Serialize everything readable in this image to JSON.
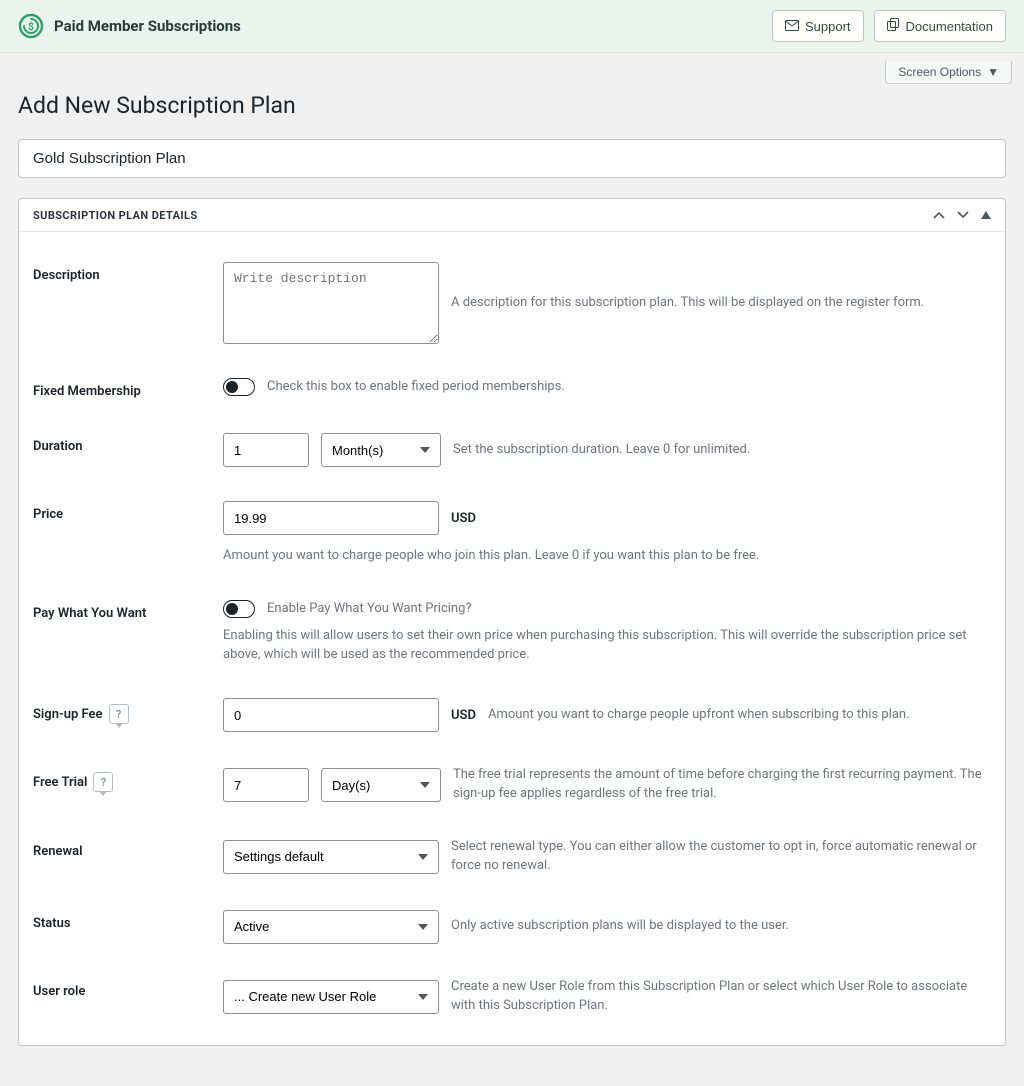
{
  "header": {
    "plugin_title": "Paid Member Subscriptions",
    "support_label": "Support",
    "documentation_label": "Documentation",
    "screen_options_label": "Screen Options"
  },
  "page": {
    "title": "Add New Subscription Plan",
    "plan_name": "Gold Subscription Plan"
  },
  "postbox": {
    "title": "SUBSCRIPTION PLAN DETAILS"
  },
  "fields": {
    "description": {
      "label": "Description",
      "placeholder": "Write description",
      "help": "A description for this subscription plan. This will be displayed on the register form."
    },
    "fixed_membership": {
      "label": "Fixed Membership",
      "help": "Check this box to enable fixed period memberships."
    },
    "duration": {
      "label": "Duration",
      "value": "1",
      "unit": "Month(s)",
      "help": "Set the subscription duration. Leave 0 for unlimited."
    },
    "price": {
      "label": "Price",
      "value": "19.99",
      "currency": "USD",
      "help": "Amount you want to charge people who join this plan. Leave 0 if you want this plan to be free."
    },
    "pwyw": {
      "label": "Pay What You Want",
      "help_inline": "Enable Pay What You Want Pricing?",
      "help_block": "Enabling this will allow users to set their own price when purchasing this subscription. This will override the subscription price set above, which will be used as the recommended price."
    },
    "signup_fee": {
      "label": "Sign-up Fee",
      "value": "0",
      "currency": "USD",
      "help": "Amount you want to charge people upfront when subscribing to this plan."
    },
    "free_trial": {
      "label": "Free Trial",
      "value": "7",
      "unit": "Day(s)",
      "help": "The free trial represents the amount of time before charging the first recurring payment. The sign-up fee applies regardless of the free trial."
    },
    "renewal": {
      "label": "Renewal",
      "value": "Settings default",
      "help": "Select renewal type. You can either allow the customer to opt in, force automatic renewal or force no renewal."
    },
    "status": {
      "label": "Status",
      "value": "Active",
      "help": "Only active subscription plans will be displayed to the user."
    },
    "user_role": {
      "label": "User role",
      "value": "... Create new User Role",
      "help": "Create a new User Role from this Subscription Plan or select which User Role to associate with this Subscription Plan."
    }
  }
}
